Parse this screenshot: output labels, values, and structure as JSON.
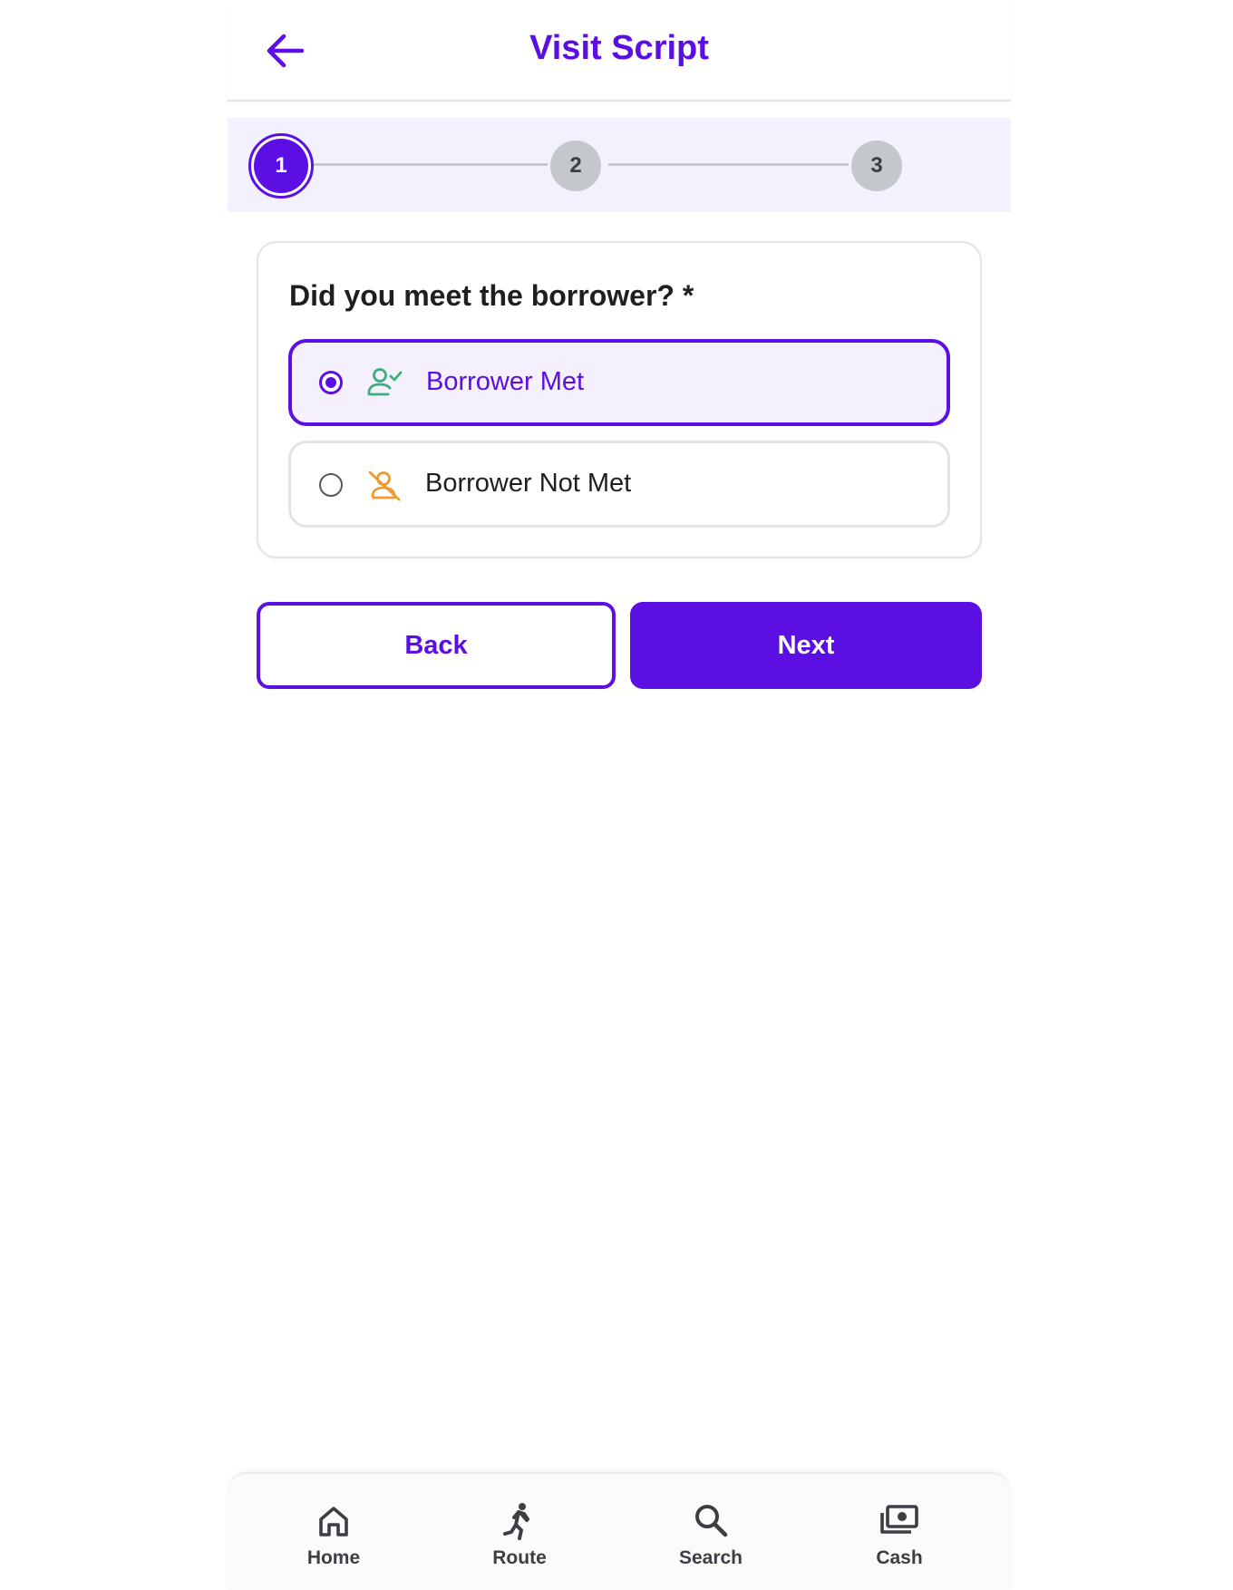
{
  "header": {
    "title": "Visit Script",
    "back_icon": "arrow-left-icon"
  },
  "stepper": {
    "steps": [
      {
        "label": "1",
        "state": "active"
      },
      {
        "label": "2",
        "state": "upcoming"
      },
      {
        "label": "3",
        "state": "upcoming"
      }
    ]
  },
  "question": {
    "text": "Did you meet the borrower? *",
    "options": [
      {
        "label": "Borrower Met",
        "selected": true,
        "icon": "user-check-icon",
        "icon_color": "#3dae7c"
      },
      {
        "label": "Borrower Not Met",
        "selected": false,
        "icon": "user-off-icon",
        "icon_color": "#ef9b30"
      }
    ]
  },
  "buttons": {
    "back_label": "Back",
    "next_label": "Next"
  },
  "bottom_nav": {
    "items": [
      {
        "label": "Home",
        "icon": "home-icon"
      },
      {
        "label": "Route",
        "icon": "running-person-icon"
      },
      {
        "label": "Search",
        "icon": "search-icon"
      },
      {
        "label": "Cash",
        "icon": "cash-icon"
      }
    ]
  },
  "colors": {
    "accent": "#5b0fe3",
    "step_inactive": "#c4c7cc",
    "stepper_bg": "#f1f2fd",
    "selected_bg": "#f5f0fd"
  }
}
